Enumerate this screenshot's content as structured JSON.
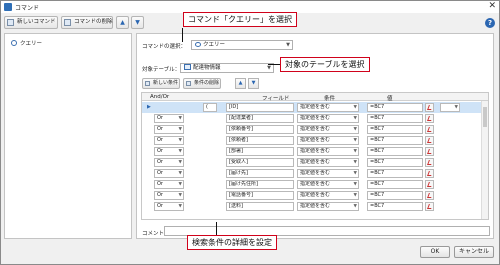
{
  "window": {
    "title": "コマンド",
    "close_glyph": "✕"
  },
  "toolbar": {
    "new_command": "新しいコマンド",
    "delete_command": "コマンドの削除",
    "up": "▲",
    "down": "▼"
  },
  "help": {
    "glyph": "?"
  },
  "sidebar": {
    "items": [
      {
        "label": "クエリー",
        "icon": "search-icon"
      }
    ]
  },
  "command_select": {
    "label": "コマンドの選択：",
    "value": "クエリー"
  },
  "target_table": {
    "label": "対象テーブル：",
    "value": "配達物情報"
  },
  "conditions_toolbar": {
    "new_condition": "新しい条件",
    "delete_condition": "条件の削除",
    "up": "▲",
    "down": "▼"
  },
  "grid": {
    "headers": {
      "andor": "And/Or",
      "field": "フィールド",
      "condition": "条件",
      "value": "値"
    },
    "rows": [
      {
        "andor": "",
        "paren": "(",
        "field": "[ID]",
        "condition": "指定値を含む",
        "value": "=BC7",
        "extra": ""
      },
      {
        "andor": "Or",
        "paren": "",
        "field": "[配達業者]",
        "condition": "指定値を含む",
        "value": "=BC7"
      },
      {
        "andor": "Or",
        "paren": "",
        "field": "[依頼番号]",
        "condition": "指定値を含む",
        "value": "=BC7"
      },
      {
        "andor": "Or",
        "paren": "",
        "field": "[依頼者]",
        "condition": "指定値を含む",
        "value": "=BC7"
      },
      {
        "andor": "Or",
        "paren": "",
        "field": "[部署]",
        "condition": "指定値を含む",
        "value": "=BC7"
      },
      {
        "andor": "Or",
        "paren": "",
        "field": "[受取人]",
        "condition": "指定値を含む",
        "value": "=BC7"
      },
      {
        "andor": "Or",
        "paren": "",
        "field": "[届け先]",
        "condition": "指定値を含む",
        "value": "=BC7"
      },
      {
        "andor": "Or",
        "paren": "",
        "field": "[届け先住所]",
        "condition": "指定値を含む",
        "value": "=BC7"
      },
      {
        "andor": "Or",
        "paren": "",
        "field": "[電話番号]",
        "condition": "指定値を含む",
        "value": "=BC7"
      },
      {
        "andor": "Or",
        "paren": "",
        "field": "[送料]",
        "condition": "指定値を含む",
        "value": "=BC7"
      }
    ]
  },
  "comment": {
    "label": "コメント",
    "value": ""
  },
  "buttons": {
    "ok": "OK",
    "cancel": "キャンセル"
  },
  "callouts": {
    "select_query": "コマンド「クエリー」を選択",
    "select_table": "対象のテーブルを選択",
    "set_conditions": "検索条件の詳細を設定"
  },
  "colors": {
    "accent": "#2b66b1",
    "callout_border": "#d0021b",
    "selected_row": "#cfe3f7"
  }
}
